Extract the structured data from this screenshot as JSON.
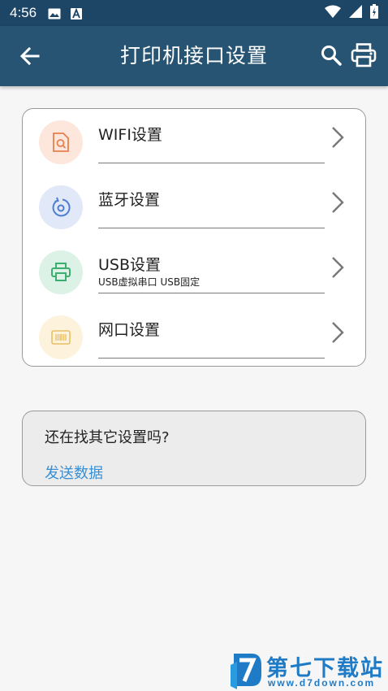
{
  "status_bar": {
    "time": "4:56",
    "icons": [
      "image-icon",
      "a-notification-icon",
      "wifi-icon",
      "signal-icon",
      "battery-icon"
    ]
  },
  "app_bar": {
    "title": "打印机接口设置",
    "back_icon": "arrow-left-icon",
    "actions": [
      "search-icon",
      "printer-icon"
    ]
  },
  "settings": {
    "items": [
      {
        "title": "WIFI设置",
        "subtitle": "",
        "icon": "document-search-icon",
        "icon_bg": "#fde6dc",
        "icon_color": "#e7804d"
      },
      {
        "title": "蓝牙设置",
        "subtitle": "",
        "icon": "rotate-circle-icon",
        "icon_bg": "#e1e8f8",
        "icon_color": "#4f7ed0"
      },
      {
        "title": "USB设置",
        "subtitle": "USB虚拟串口 USB固定",
        "icon": "printer-icon",
        "icon_bg": "#dcf2e6",
        "icon_color": "#3cae70"
      },
      {
        "title": "网口设置",
        "subtitle": "",
        "icon": "barcode-icon",
        "icon_bg": "#fdf3dd",
        "icon_color": "#e8c064"
      }
    ]
  },
  "help": {
    "question": "还在找其它设置吗?",
    "link": "发送数据"
  },
  "watermark": {
    "name": "第七下载站",
    "url": "www.d7down.com"
  },
  "colors": {
    "status_bar": "#1d4566",
    "app_bar": "#285473",
    "link": "#3a8fd4",
    "watermark": "#1f7bc6"
  }
}
